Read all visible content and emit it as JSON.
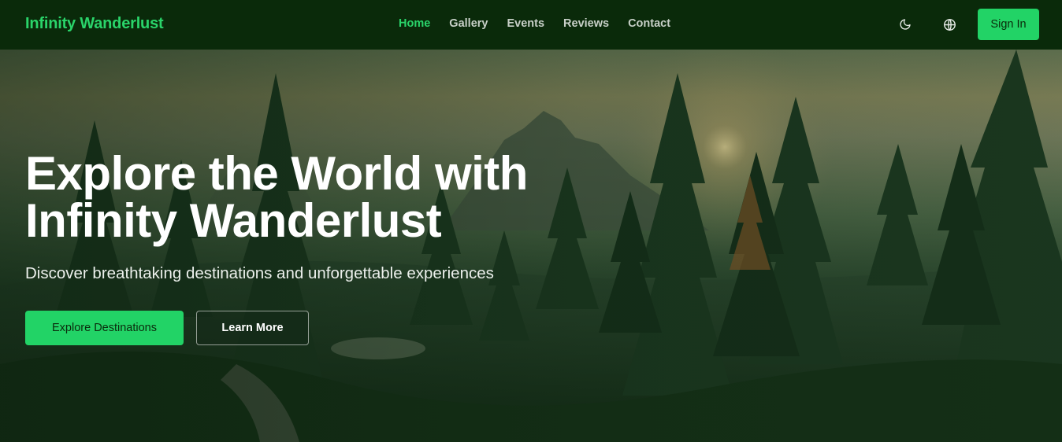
{
  "brand": {
    "name": "Infinity Wanderlust"
  },
  "nav": {
    "links": [
      {
        "label": "Home",
        "active": true
      },
      {
        "label": "Gallery",
        "active": false
      },
      {
        "label": "Events",
        "active": false
      },
      {
        "label": "Reviews",
        "active": false
      },
      {
        "label": "Contact",
        "active": false
      }
    ],
    "icons": {
      "theme": "moon-icon",
      "language": "globe-icon"
    },
    "signin_label": "Sign In"
  },
  "hero": {
    "title_line1": "Explore the World with",
    "title_line2": "Infinity Wanderlust",
    "subtitle": "Discover breathtaking destinations and unforgettable experiences",
    "primary_button": "Explore Destinations",
    "secondary_button": "Learn More"
  },
  "colors": {
    "accent": "#22d366",
    "brand_text": "#2ad46a",
    "navbar_bg": "#0a2a0a",
    "nav_text": "#c8d0c8"
  }
}
